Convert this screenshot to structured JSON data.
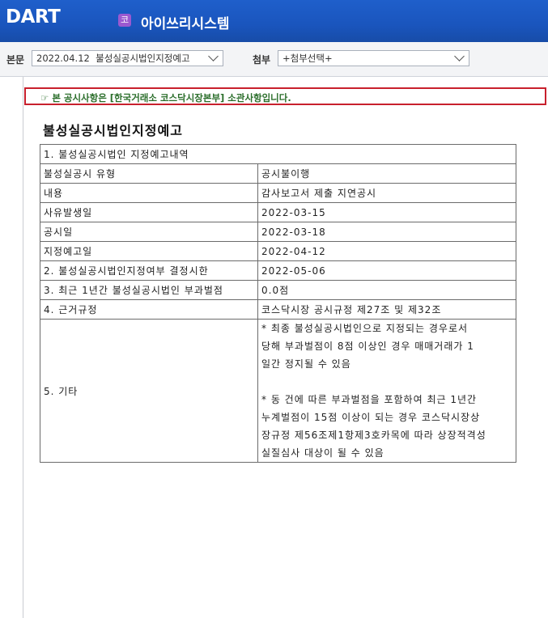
{
  "header": {
    "logo_text": "DART",
    "corp_badge": "코",
    "company_name": "아이쓰리시스템"
  },
  "toolbar": {
    "body_label": "본문",
    "body_select": "2022.04.12  불성실공시법인지정예고",
    "attach_label": "첨부",
    "attach_select": "+첨부선택+"
  },
  "notice": {
    "text": "☞ 본 공시사항은 [한국거래소 코스닥시장본부] 소관사항입니다."
  },
  "document": {
    "title": "불성실공시법인지정예고",
    "section1": "1. 불성실공시법인 지정예고내역",
    "rows": [
      {
        "label": "불성실공시 유형",
        "value": "공시불이행"
      },
      {
        "label": "내용",
        "value": "감사보고서 제출 지연공시"
      },
      {
        "label": "사유발생일",
        "value": "2022-03-15"
      },
      {
        "label": "공시일",
        "value": "2022-03-18"
      },
      {
        "label": "지정예고일",
        "value": "2022-04-12"
      },
      {
        "label": "2. 불성실공시법인지정여부 결정시한",
        "value": "2022-05-06"
      },
      {
        "label": "3. 최근 1년간 불성실공시법인 부과벌점",
        "value": "0.0점"
      },
      {
        "label": "4. 근거규정",
        "value": "코스닥시장 공시규정 제27조 및 제32조"
      }
    ],
    "etc_label": "5. 기타",
    "etc_lines_1": [
      "* 최종 불성실공시법인으로 지정되는 경우로서",
      "당해 부과벌점이 8점 이상인 경우 매매거래가 1",
      "일간 정지될 수 있음"
    ],
    "etc_lines_2": [
      "* 동 건에 따른 부과벌점을 포함하여 최근 1년간",
      "누계벌점이 15점 이상이 되는 경우 코스닥시장상",
      "장규정 제56조제1항제3호카목에 따라 상장적격성",
      "실질심사 대상이 될 수 있음"
    ]
  }
}
